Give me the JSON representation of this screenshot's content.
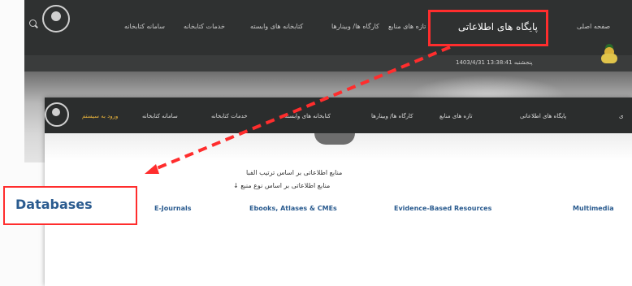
{
  "top_screenshot": {
    "nav_items": [
      "صفحه اصلی",
      "سامانه کتابخانه",
      "خدمات کتابخانه",
      "کتابخانه های وابسته",
      "کارگاه ها/ وبینارها",
      "تازه های منابع"
    ],
    "date_text": "پنجشنبه 13:38:41 1403/4/31",
    "highlighted_item": "پایگاه های اطلاعاتی"
  },
  "bottom_screenshot": {
    "nav_items": [
      "پایگاه های اطلاعاتی",
      "تازه های منابع",
      "کارگاه ها/ وبینارها",
      "کتابخانه های وابسته",
      "خدمات کتابخانه",
      "سامانه کتابخانه"
    ],
    "login_label": "ورود به سیستم",
    "partial_nav_item": "ی",
    "links": {
      "alphabetical": "منابع اطلاعاتی بر اساس ترتیب الفبا",
      "by_type": "منابع اطلاعاتی بر اساس نوع منبع ↓"
    },
    "categories": [
      "E-Journals",
      "Ebooks, Atlases & CMEs",
      "Evidence-Based Resources",
      "Multimedia"
    ]
  },
  "annotation": {
    "databases_label": "Databases"
  },
  "colors": {
    "highlight_red": "#ff2d2d",
    "link_blue": "#2a5b8f",
    "nav_dark": "#2f3131",
    "login_gold": "#e7b23c"
  }
}
